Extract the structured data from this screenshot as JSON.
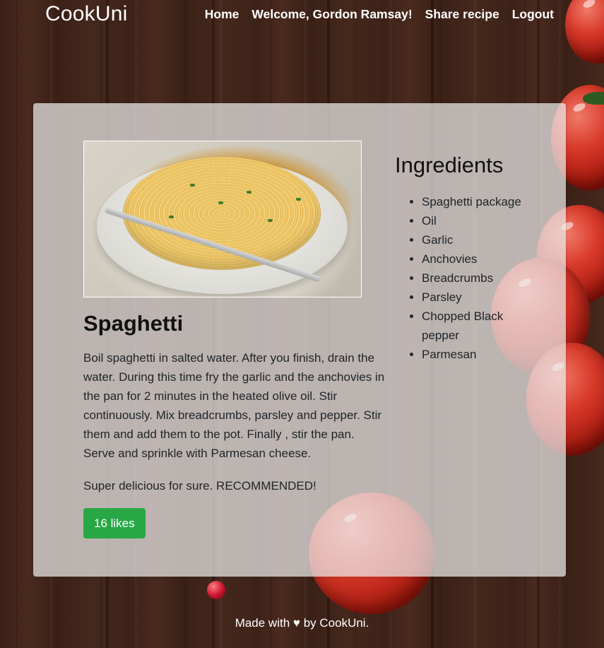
{
  "navbar": {
    "brand": "CookUni",
    "links": [
      {
        "label": "Home"
      },
      {
        "label": "Welcome, Gordon Ramsay!"
      },
      {
        "label": "Share recipe"
      },
      {
        "label": "Logout"
      }
    ]
  },
  "recipe": {
    "title": "Spaghetti",
    "description": "Boil spaghetti in salted water. After you finish, drain the water. During this time fry the garlic and the anchovies in the pan for 2 minutes in the heated olive oil. Stir continuously. Mix breadcrumbs, parsley and pepper. Stir them and add them to the pot. Finally , stir the pan. Serve and sprinkle with Parmesan cheese.",
    "note": "Super delicious for sure. RECOMMENDED!",
    "likes_label": "16 likes",
    "image_alt": "Spaghetti",
    "ingredients_heading": "Ingredients",
    "ingredients": [
      "Spaghetti package",
      "Oil",
      "Garlic",
      "Anchovies",
      "Breadcrumbs",
      "Parsley",
      "Chopped Black pepper",
      "Parmesan"
    ]
  },
  "footer": {
    "text": "Made with ♥ by CookUni."
  },
  "colors": {
    "likes_button": "#28a745",
    "card_background": "rgba(235,235,235,0.72)",
    "nav_text": "#ffffff"
  }
}
